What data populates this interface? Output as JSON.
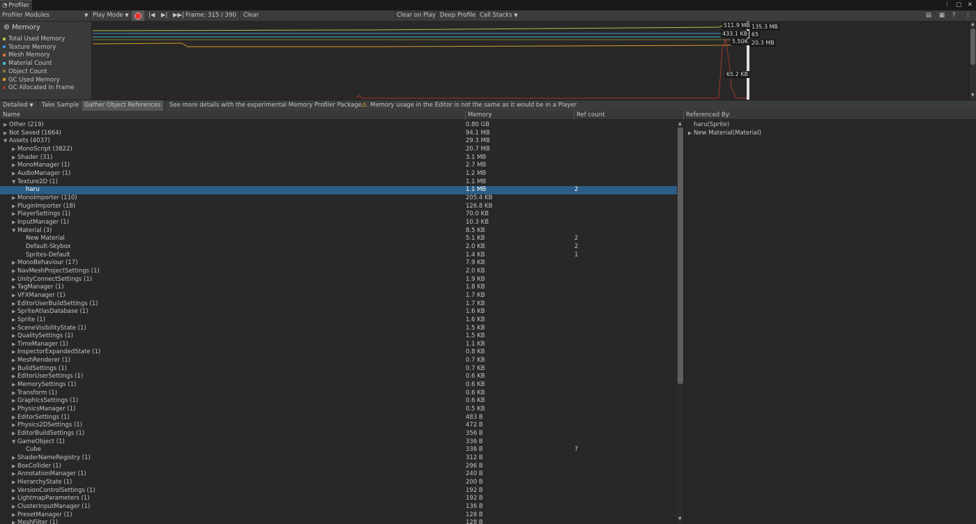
{
  "window": {
    "tab_label": "Profiler",
    "controls": "⋮ ▢ ✕"
  },
  "toolbar": {
    "modules": "Profiler Modules",
    "play_mode": "Play Mode",
    "frame": "Frame: 315 / 390",
    "clear": "Clear",
    "clear_on_play": "Clear on Play",
    "deep_profile": "Deep Profile",
    "call_stacks": "Call Stacks"
  },
  "memory_module": {
    "title": "Memory",
    "legend": [
      {
        "label": "Total Used Memory",
        "color": "#b5c24a"
      },
      {
        "label": "Texture Memory",
        "color": "#3f8fd8"
      },
      {
        "label": "Mesh Memory",
        "color": "#d9713a"
      },
      {
        "label": "Material Count",
        "color": "#3fb2c8"
      },
      {
        "label": "Object Count",
        "color": "#7f7a3c"
      },
      {
        "label": "GC Used Memory",
        "color": "#d79d2a"
      },
      {
        "label": "GC Allocated In Frame",
        "color": "#a0382f"
      }
    ],
    "readouts": [
      "511.9 MB",
      "135.3 MB",
      "433.1 KB",
      "65",
      "5.50K",
      "20.3 MB",
      "65.2 KB"
    ]
  },
  "sub_toolbar": {
    "view": "Detailed",
    "take_sample": "Take Sample",
    "gather": "Gather Object References",
    "hint": "See more details with the experimental Memory Profiler Package.",
    "warning": "Memory usage in the Editor is not the same as it would be in a Player"
  },
  "columns": {
    "name": "Name",
    "memory": "Memory",
    "ref": "Ref count",
    "referenced_by": "Referenced By:"
  },
  "rows": [
    {
      "name": "Other (219)",
      "mem": "0.80 GB",
      "ref": "",
      "depth": 0,
      "exp": "collapsed"
    },
    {
      "name": "Not Saved (1664)",
      "mem": "94.1 MB",
      "ref": "",
      "depth": 0,
      "exp": "collapsed"
    },
    {
      "name": "Assets (4037)",
      "mem": "29.3 MB",
      "ref": "",
      "depth": 0,
      "exp": "expanded"
    },
    {
      "name": "MonoScript (3822)",
      "mem": "20.7 MB",
      "ref": "",
      "depth": 1,
      "exp": "collapsed"
    },
    {
      "name": "Shader (31)",
      "mem": "3.1 MB",
      "ref": "",
      "depth": 1,
      "exp": "collapsed"
    },
    {
      "name": "MonoManager (1)",
      "mem": "2.7 MB",
      "ref": "",
      "depth": 1,
      "exp": "collapsed"
    },
    {
      "name": "AudioManager (1)",
      "mem": "1.2 MB",
      "ref": "",
      "depth": 1,
      "exp": "collapsed"
    },
    {
      "name": "Texture2D (1)",
      "mem": "1.1 MB",
      "ref": "",
      "depth": 1,
      "exp": "expanded"
    },
    {
      "name": "haru",
      "mem": "1.1 MB",
      "ref": "2",
      "depth": 2,
      "exp": "",
      "sel": true
    },
    {
      "name": "MonoImporter (110)",
      "mem": "205.4 KB",
      "ref": "",
      "depth": 1,
      "exp": "collapsed"
    },
    {
      "name": "PluginImporter (18)",
      "mem": "126.8 KB",
      "ref": "",
      "depth": 1,
      "exp": "collapsed"
    },
    {
      "name": "PlayerSettings (1)",
      "mem": "70.0 KB",
      "ref": "",
      "depth": 1,
      "exp": "collapsed"
    },
    {
      "name": "InputManager (1)",
      "mem": "10.3 KB",
      "ref": "",
      "depth": 1,
      "exp": "collapsed"
    },
    {
      "name": "Material (3)",
      "mem": "8.5 KB",
      "ref": "",
      "depth": 1,
      "exp": "expanded"
    },
    {
      "name": "New Material",
      "mem": "5.1 KB",
      "ref": "2",
      "depth": 2,
      "exp": ""
    },
    {
      "name": "Default-Skybox",
      "mem": "2.0 KB",
      "ref": "2",
      "depth": 2,
      "exp": ""
    },
    {
      "name": "Sprites-Default",
      "mem": "1.4 KB",
      "ref": "1",
      "depth": 2,
      "exp": ""
    },
    {
      "name": "MonoBehaviour (17)",
      "mem": "7.9 KB",
      "ref": "",
      "depth": 1,
      "exp": "collapsed"
    },
    {
      "name": "NavMeshProjectSettings (1)",
      "mem": "2.0 KB",
      "ref": "",
      "depth": 1,
      "exp": "collapsed"
    },
    {
      "name": "UnityConnectSettings (1)",
      "mem": "1.9 KB",
      "ref": "",
      "depth": 1,
      "exp": "collapsed"
    },
    {
      "name": "TagManager (1)",
      "mem": "1.8 KB",
      "ref": "",
      "depth": 1,
      "exp": "collapsed"
    },
    {
      "name": "VFXManager (1)",
      "mem": "1.7 KB",
      "ref": "",
      "depth": 1,
      "exp": "collapsed"
    },
    {
      "name": "EditorUserBuildSettings (1)",
      "mem": "1.7 KB",
      "ref": "",
      "depth": 1,
      "exp": "collapsed"
    },
    {
      "name": "SpriteAtlasDatabase (1)",
      "mem": "1.6 KB",
      "ref": "",
      "depth": 1,
      "exp": "collapsed"
    },
    {
      "name": "Sprite (1)",
      "mem": "1.6 KB",
      "ref": "",
      "depth": 1,
      "exp": "collapsed"
    },
    {
      "name": "SceneVisibilityState (1)",
      "mem": "1.5 KB",
      "ref": "",
      "depth": 1,
      "exp": "collapsed"
    },
    {
      "name": "QualitySettings (1)",
      "mem": "1.5 KB",
      "ref": "",
      "depth": 1,
      "exp": "collapsed"
    },
    {
      "name": "TimeManager (1)",
      "mem": "1.1 KB",
      "ref": "",
      "depth": 1,
      "exp": "collapsed"
    },
    {
      "name": "InspectorExpandedState (1)",
      "mem": "0.8 KB",
      "ref": "",
      "depth": 1,
      "exp": "collapsed"
    },
    {
      "name": "MeshRenderer (1)",
      "mem": "0.7 KB",
      "ref": "",
      "depth": 1,
      "exp": "collapsed"
    },
    {
      "name": "BuildSettings (1)",
      "mem": "0.7 KB",
      "ref": "",
      "depth": 1,
      "exp": "collapsed"
    },
    {
      "name": "EditorUserSettings (1)",
      "mem": "0.6 KB",
      "ref": "",
      "depth": 1,
      "exp": "collapsed"
    },
    {
      "name": "MemorySettings (1)",
      "mem": "0.6 KB",
      "ref": "",
      "depth": 1,
      "exp": "collapsed"
    },
    {
      "name": "Transform (1)",
      "mem": "0.6 KB",
      "ref": "",
      "depth": 1,
      "exp": "collapsed"
    },
    {
      "name": "GraphicsSettings (1)",
      "mem": "0.6 KB",
      "ref": "",
      "depth": 1,
      "exp": "collapsed"
    },
    {
      "name": "PhysicsManager (1)",
      "mem": "0.5 KB",
      "ref": "",
      "depth": 1,
      "exp": "collapsed"
    },
    {
      "name": "EditorSettings (1)",
      "mem": "483 B",
      "ref": "",
      "depth": 1,
      "exp": "collapsed"
    },
    {
      "name": "Physics2DSettings (1)",
      "mem": "472 B",
      "ref": "",
      "depth": 1,
      "exp": "collapsed"
    },
    {
      "name": "EditorBuildSettings (1)",
      "mem": "356 B",
      "ref": "",
      "depth": 1,
      "exp": "collapsed"
    },
    {
      "name": "GameObject (1)",
      "mem": "336 B",
      "ref": "",
      "depth": 1,
      "exp": "expanded"
    },
    {
      "name": "Cube",
      "mem": "336 B",
      "ref": "7",
      "depth": 2,
      "exp": ""
    },
    {
      "name": "ShaderNameRegistry (1)",
      "mem": "312 B",
      "ref": "",
      "depth": 1,
      "exp": "collapsed"
    },
    {
      "name": "BoxCollider (1)",
      "mem": "296 B",
      "ref": "",
      "depth": 1,
      "exp": "collapsed"
    },
    {
      "name": "AnnotationManager (1)",
      "mem": "240 B",
      "ref": "",
      "depth": 1,
      "exp": "collapsed"
    },
    {
      "name": "HierarchyState (1)",
      "mem": "200 B",
      "ref": "",
      "depth": 1,
      "exp": "collapsed"
    },
    {
      "name": "VersionControlSettings (1)",
      "mem": "192 B",
      "ref": "",
      "depth": 1,
      "exp": "collapsed"
    },
    {
      "name": "LightmapParameters (1)",
      "mem": "192 B",
      "ref": "",
      "depth": 1,
      "exp": "collapsed"
    },
    {
      "name": "ClusterInputManager (1)",
      "mem": "136 B",
      "ref": "",
      "depth": 1,
      "exp": "collapsed"
    },
    {
      "name": "PresetManager (1)",
      "mem": "128 B",
      "ref": "",
      "depth": 1,
      "exp": "collapsed"
    },
    {
      "name": "MeshFilter (1)",
      "mem": "128 B",
      "ref": "",
      "depth": 1,
      "exp": "collapsed"
    }
  ],
  "referenced_by": [
    {
      "name": "haru(Sprite)",
      "exp": ""
    },
    {
      "name": "New Material(Material)",
      "exp": "collapsed"
    }
  ]
}
